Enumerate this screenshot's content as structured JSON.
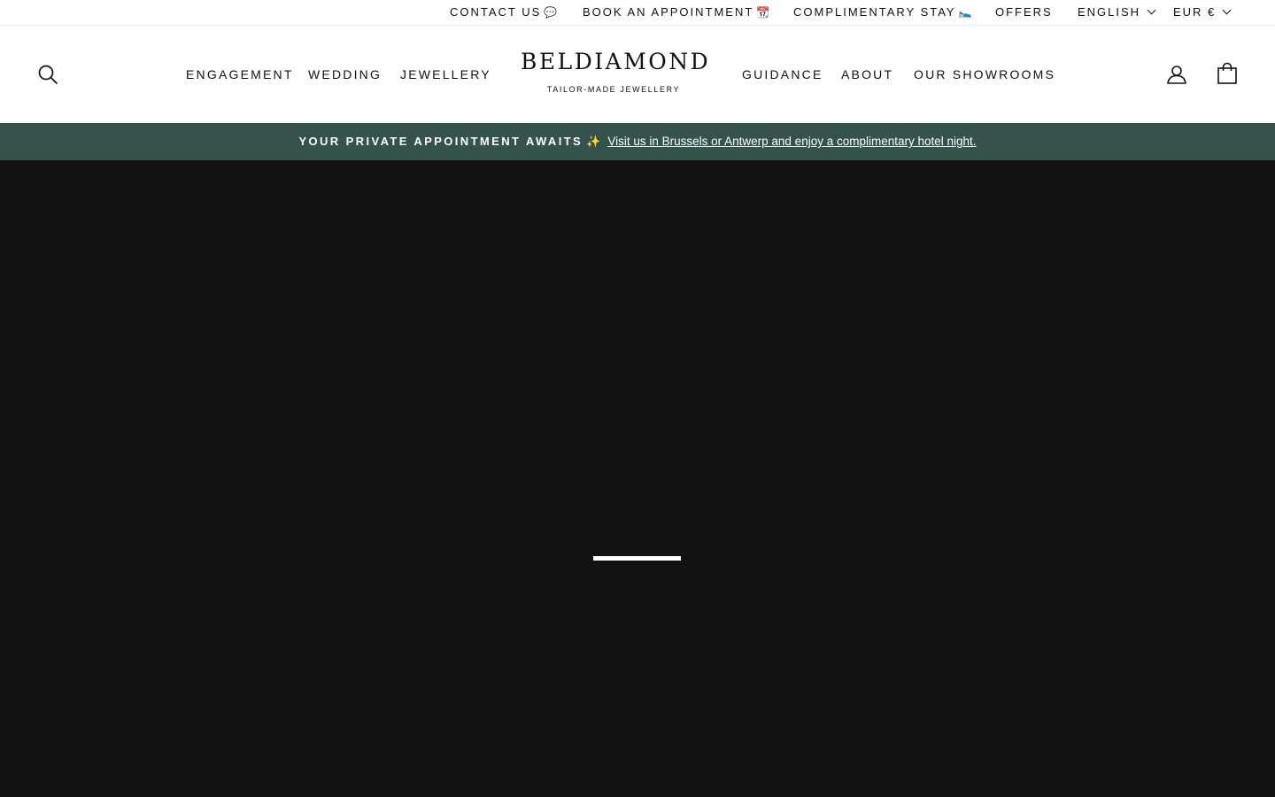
{
  "topbar": {
    "contact": {
      "label": "CONTACT US",
      "emoji": "💬"
    },
    "appointment": {
      "label": "BOOK AN APPOINTMENT",
      "emoji": "📆"
    },
    "stay": {
      "label": "COMPLIMENTARY STAY",
      "emoji": "🛌"
    },
    "offers": "OFFERS",
    "language": "ENGLISH",
    "currency": "EUR €"
  },
  "header": {
    "nav_left": [
      "ENGAGEMENT",
      "WEDDING",
      "JEWELLERY"
    ],
    "nav_right": [
      "GUIDANCE",
      "ABOUT",
      "OUR SHOWROOMS"
    ],
    "logo": {
      "name": "BELDIAMOND",
      "tagline": "TAILOR-MADE JEWELLERY"
    },
    "icons": {
      "search": "search-icon",
      "account": "user-icon",
      "cart": "bag-icon"
    }
  },
  "banner": {
    "lead": "YOUR PRIVATE APPOINTMENT AWAITS",
    "spark": "✨",
    "link": "Visit us in Brussels or Antwerp and enjoy a complimentary hotel night."
  },
  "colors": {
    "banner_bg": "#35524c",
    "hero_bg": "#111111",
    "text": "#111111"
  }
}
